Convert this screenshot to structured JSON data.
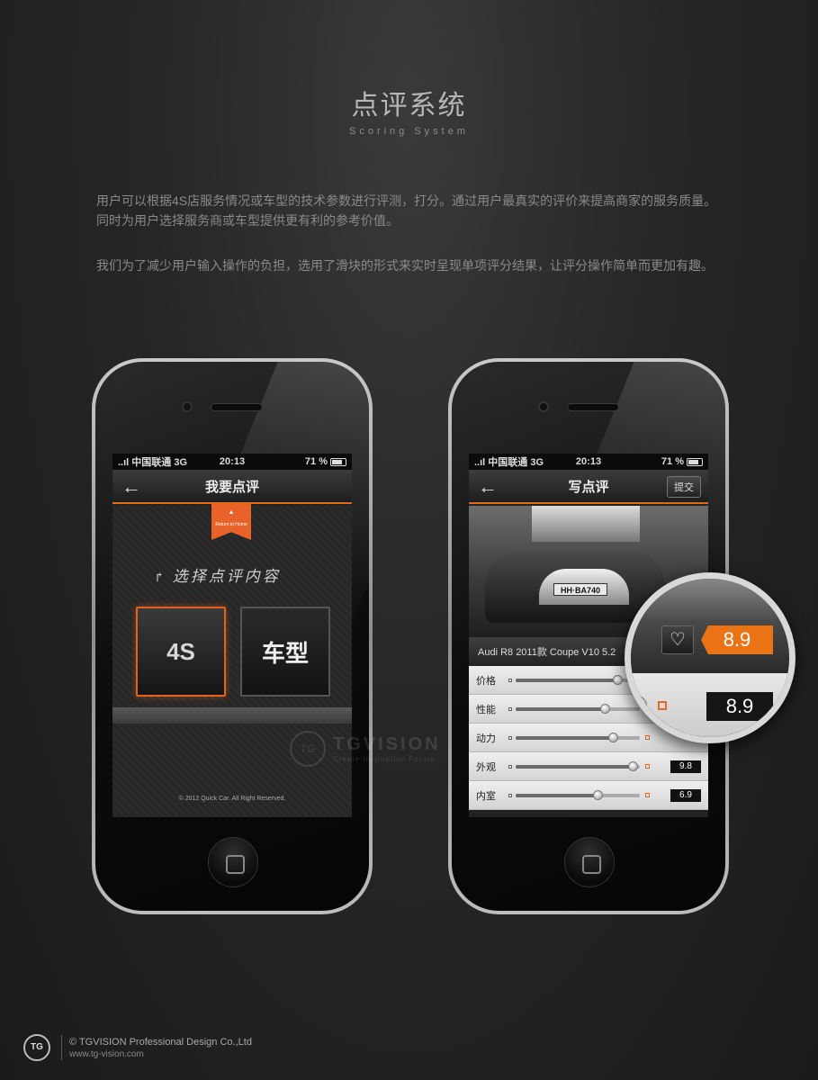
{
  "header": {
    "title": "点评系统",
    "subtitle": "Scoring System"
  },
  "description": {
    "line1": "用户可以根据4S店服务情况或车型的技术参数进行评测，打分。通过用户最真实的评价来提高商家的服务质量。",
    "line2": "同时为用户选择服务商或车型提供更有利的参考价值。",
    "line3": "我们为了减少用户输入操作的负担，选用了滑块的形式来实时呈现单项评分结果，让评分操作简单而更加有趣。"
  },
  "status_bar": {
    "carrier": "..ıl 中国联通  3G",
    "time": "20:13",
    "battery": "71 %"
  },
  "left_screen": {
    "title": "我要点评",
    "back_icon": "←",
    "ribbon_label": "Return to Home",
    "choose_label": "选择点评内容",
    "choose_hook": "↱",
    "tiles": [
      {
        "label": "4S"
      },
      {
        "label": "车型"
      }
    ],
    "footer": "© 2012 Quick Car. All Right Reserved."
  },
  "right_screen": {
    "title": "写点评",
    "back_icon": "←",
    "submit_label": "提交",
    "plate": "HH·BA740",
    "caption": "Audi R8 2011款 Coupe V10 5.2",
    "rows": [
      {
        "label": "价格",
        "value": "8.9",
        "fraction": 0.82
      },
      {
        "label": "性能",
        "value": "8.9",
        "fraction": 0.72
      },
      {
        "label": "动力",
        "value": "",
        "fraction": 0.78
      },
      {
        "label": "外观",
        "value": "9.8",
        "fraction": 0.94
      },
      {
        "label": "内室",
        "value": "6.9",
        "fraction": 0.66
      }
    ]
  },
  "magnifier": {
    "heart_icon": "♡",
    "score_top": "8.9",
    "score_bottom": "8.9"
  },
  "watermark": {
    "logo": "TG",
    "brand": "TGVISION",
    "tagline": "Create Inspiration Future"
  },
  "footer": {
    "logo": "TG",
    "line1": "© TGVISION Professional Design Co.,Ltd",
    "line2": "www.tg-vision.com"
  }
}
